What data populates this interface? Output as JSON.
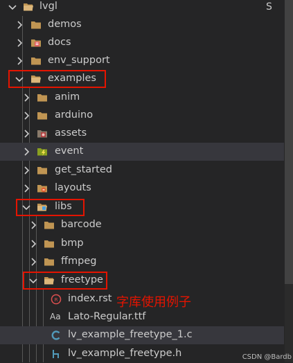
{
  "explorer": {
    "status_letter": "S",
    "watermark": "CSDN @Bardb",
    "annotation": "字库使用例子",
    "items": [
      {
        "label": "lvgl"
      },
      {
        "label": "demos"
      },
      {
        "label": "docs"
      },
      {
        "label": "env_support"
      },
      {
        "label": "examples"
      },
      {
        "label": "anim"
      },
      {
        "label": "arduino"
      },
      {
        "label": "assets"
      },
      {
        "label": "event"
      },
      {
        "label": "get_started"
      },
      {
        "label": "layouts"
      },
      {
        "label": "libs"
      },
      {
        "label": "barcode"
      },
      {
        "label": "bmp"
      },
      {
        "label": "ffmpeg"
      },
      {
        "label": "freetype"
      },
      {
        "label": "index.rst"
      },
      {
        "label": "Lato-Regular.ttf"
      },
      {
        "label": "lv_example_freetype_1.c"
      },
      {
        "label": "lv_example_freetype.h"
      }
    ]
  },
  "colors": {
    "background": "#252526",
    "selected_row": "#37373d",
    "folder": "#c09553",
    "highlight_box": "#e51400",
    "c_file": "#519aba"
  }
}
